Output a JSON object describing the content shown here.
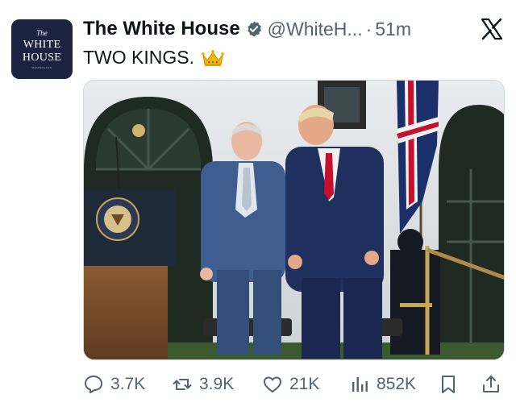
{
  "account": {
    "avatar_line1": "The",
    "avatar_line2": "WHITE",
    "avatar_line3": "HOUSE",
    "avatar_line4": "WASHINGTON",
    "name": "The White House",
    "handle": "@WhiteH...",
    "separator": "·",
    "time": "51m"
  },
  "tweet": {
    "text": "TWO KINGS.",
    "emoji_icon": "crown-icon"
  },
  "metrics": {
    "replies": "3.7K",
    "reposts": "3.9K",
    "likes": "21K",
    "views": "852K"
  },
  "colors": {
    "verified": "#536471",
    "muted": "#536471",
    "avatar_bg": "#1b2340"
  }
}
